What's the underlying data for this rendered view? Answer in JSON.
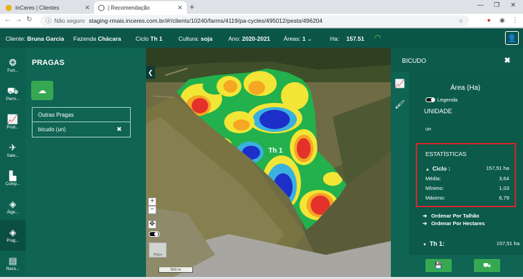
{
  "browser": {
    "tabs": [
      {
        "label": "InCeres | Clientes",
        "active": false,
        "favicon_color": "#e8b21c"
      },
      {
        "label": "| Recomendação",
        "active": true,
        "favicon_color": "#555555"
      }
    ],
    "security_label": "Não seguro",
    "url": "staging-rmais.inceres.com.br/#!/clients/10240/farms/4119/pa-cycles/495012/pests/496204"
  },
  "header": {
    "cliente_label": "Cliente:",
    "cliente_value": "Bruna Garcia",
    "fazenda_label": "Fazenda",
    "fazenda_value": "Chácara",
    "ciclo_label": "Ciclo",
    "ciclo_value": "Th 1",
    "cultura_label": "Cultura:",
    "cultura_value": "soja",
    "ano_label": "Ano:",
    "ano_value": "2020-2021",
    "areas_label": "Áreas:",
    "areas_value": "1",
    "ha_label": "Ha:",
    "ha_value": "157.51"
  },
  "sidebar": {
    "items": [
      {
        "label": "Fert...",
        "icon": "fertilizer-icon"
      },
      {
        "label": "Perm...",
        "icon": "tractor-icon"
      },
      {
        "label": "Prod...",
        "icon": "chart-line-icon"
      },
      {
        "label": "Sate...",
        "icon": "satellite-icon"
      },
      {
        "label": "Comp...",
        "icon": "factory-icon"
      },
      {
        "label": "Álge...",
        "icon": "layers-icon"
      },
      {
        "label": "Prag...",
        "icon": "layers-icon"
      },
      {
        "label": "Reco...",
        "icon": "document-icon"
      }
    ]
  },
  "pragas": {
    "title": "PRAGAS",
    "items": [
      {
        "label": "Outras Pragas"
      },
      {
        "label": "bicudo (un)"
      }
    ]
  },
  "map": {
    "field_label": "Th 1",
    "scale_label": "500 m",
    "minimap_label": "Mapa"
  },
  "right_panel": {
    "title": "BICUDO",
    "area_title": "Área (Ha)",
    "legend_label": "Legenda",
    "unidade_label": "UNIDADE",
    "unidade_value": "un",
    "stats": {
      "title": "ESTATÍSTICAS",
      "ciclo_label": "Ciclo :",
      "ciclo_value": "157,51 ha",
      "media_label": "Média:",
      "media_value": "3,64",
      "minimo_label": "Mínimo:",
      "minimo_value": "1,03",
      "maximo_label": "Máximo:",
      "maximo_value": "6,79"
    },
    "order_talhao": "Ordenar Por Talhão",
    "order_hectares": "Ordenar Por Hectares",
    "th_label": "Th 1:",
    "th_value": "157,51 ha"
  },
  "colors": {
    "header_bg": "#0b5549",
    "panel_bg": "#0f6453",
    "accent_green": "#36a852",
    "highlight_red": "#d6262a"
  }
}
